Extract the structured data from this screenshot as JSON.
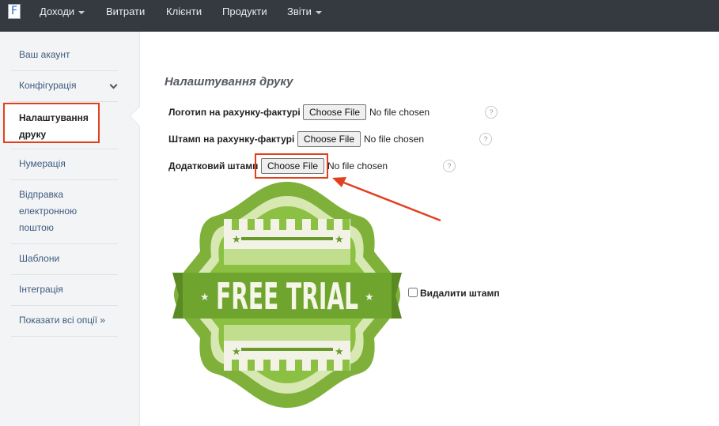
{
  "topbar": {
    "logo_letter": "F",
    "nav": [
      {
        "label": "Доходи"
      },
      {
        "label": "Витрати"
      },
      {
        "label": "Клієнти"
      },
      {
        "label": "Продукти"
      },
      {
        "label": "Звіти"
      }
    ]
  },
  "sidebar": {
    "items": [
      {
        "label": "Ваш акаунт"
      },
      {
        "label": "Конфігурація"
      },
      {
        "label": "Налаштування друку"
      },
      {
        "label": "Нумерація"
      },
      {
        "label": "Відправка електронною поштою"
      },
      {
        "label": "Шаблони"
      },
      {
        "label": "Інтеграція"
      },
      {
        "label": "Показати всі опції »"
      }
    ]
  },
  "main": {
    "title": "Налаштування друку",
    "rows": [
      {
        "label": "Логотип на рахунку-фактурі",
        "button": "Choose File",
        "status": "No file chosen",
        "help": "?"
      },
      {
        "label": "Штамп на рахунку-фактурі",
        "button": "Choose File",
        "status": "No file chosen",
        "help": "?"
      },
      {
        "label": "Додатковий штамп",
        "button": "Choose File",
        "status": "No file chosen",
        "help": "?"
      }
    ],
    "stamp_text": "FREE TRIAL",
    "remove_stamp_label": "Видалити штамп"
  },
  "colors": {
    "topbar": "#343a40",
    "highlight": "#e2401c",
    "link": "#3d5a80",
    "stamp_green": "#7fb13a"
  }
}
